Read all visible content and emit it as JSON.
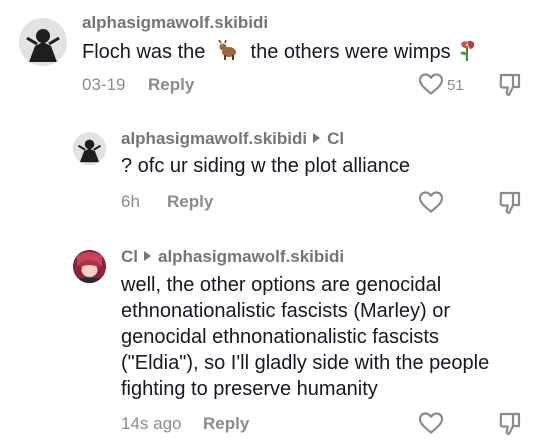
{
  "comments": [
    {
      "username": "alphasigmawolf.skibidi",
      "text_before": "Floch was the",
      "text_after": "the others were wimps",
      "timestamp": "03-19",
      "reply_label": "Reply",
      "like_count": "51"
    },
    {
      "username": "alphasigmawolf.skibidi",
      "reply_to": "Cl",
      "text": "? ofc ur siding w the plot alliance",
      "timestamp": "6h",
      "reply_label": "Reply"
    },
    {
      "username": "Cl",
      "reply_to": "alphasigmawolf.skibidi",
      "text_lines": [
        "well, the other options are genocidal",
        "ethnonationalistic fascists (Marley) or",
        "genocidal ethnonationalistic fascists",
        "(\"Eldia\"), so I'll gladly side with the people",
        "fighting to preserve humanity"
      ],
      "timestamp": "14s ago",
      "reply_label": "Reply"
    }
  ],
  "icons": {
    "like": "heart-outline-icon",
    "dislike": "thumbs-down-outline-icon",
    "emoji_goat": "goat-emoji",
    "emoji_flower": "wilted-rose-emoji"
  },
  "colors": {
    "text": "#161823",
    "secondary": "#8a8b91",
    "username": "#74757a"
  }
}
